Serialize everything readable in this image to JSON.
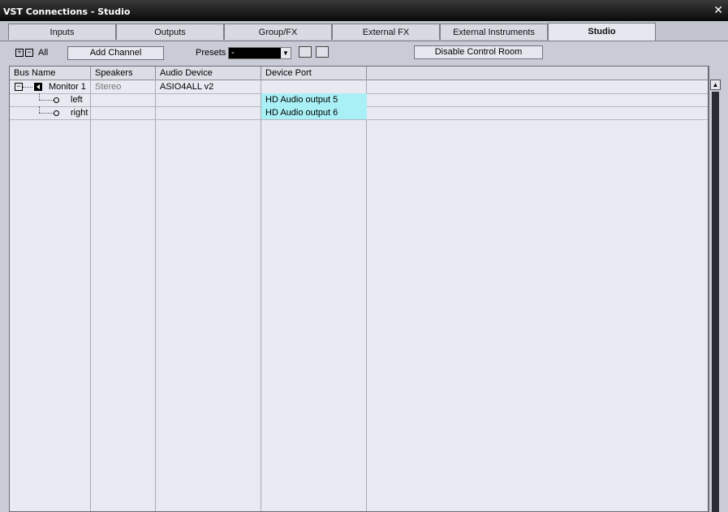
{
  "window": {
    "title": "VST Connections - Studio",
    "close_glyph": "✕"
  },
  "tabs": [
    {
      "label": "Inputs"
    },
    {
      "label": "Outputs"
    },
    {
      "label": "Group/FX"
    },
    {
      "label": "External FX"
    },
    {
      "label": "External Instruments"
    },
    {
      "label": "Studio",
      "active": true
    }
  ],
  "toolbar": {
    "all_label": "All",
    "add_channel": "Add Channel",
    "presets_label": "Presets",
    "presets_value": "-",
    "disable_control_room": "Disable Control Room"
  },
  "table": {
    "headers": [
      "Bus Name",
      "Speakers",
      "Audio Device",
      "Device Port"
    ],
    "rows": [
      {
        "bus": "Monitor 1",
        "speakers": "Stereo",
        "device": "ASIO4ALL v2",
        "port": ""
      },
      {
        "bus": "left",
        "speakers": "",
        "device": "",
        "port": "HD Audio output 5"
      },
      {
        "bus": "right",
        "speakers": "",
        "device": "",
        "port": "HD Audio output 6"
      }
    ]
  },
  "colors": {
    "port_highlight": "#a9f0f6",
    "titlebar": "#111111"
  }
}
